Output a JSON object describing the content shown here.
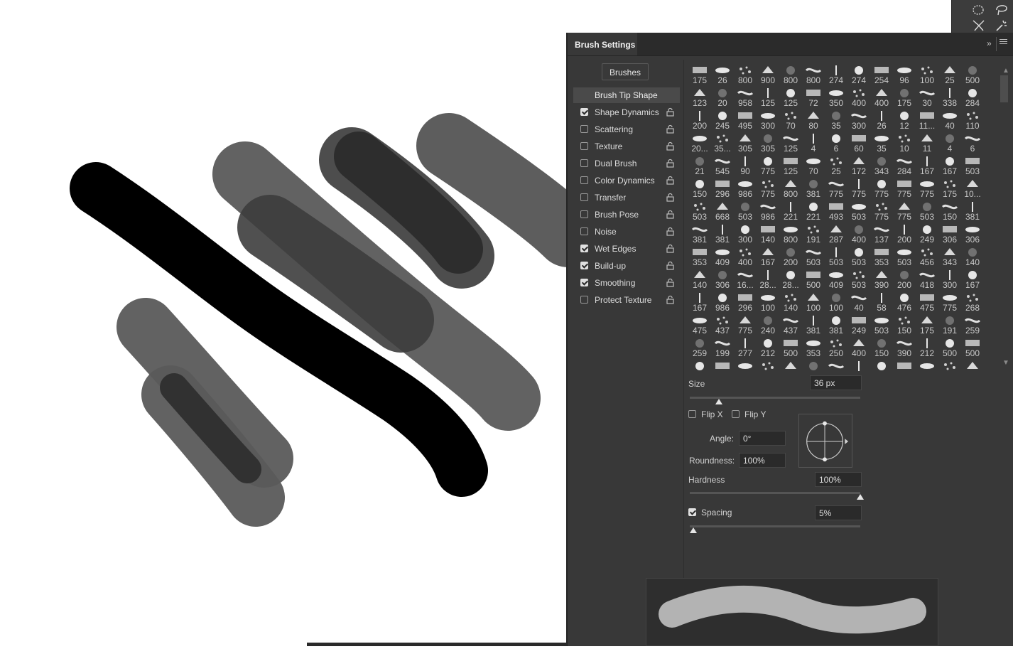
{
  "panel": {
    "title": "Brush Settings",
    "expand_glyph": "»",
    "brushes_button": "Brushes",
    "tip_shape_label": "Brush Tip Shape",
    "options": [
      {
        "label": "Shape Dynamics",
        "checked": true
      },
      {
        "label": "Scattering",
        "checked": false
      },
      {
        "label": "Texture",
        "checked": false
      },
      {
        "label": "Dual Brush",
        "checked": false
      },
      {
        "label": "Color Dynamics",
        "checked": false
      },
      {
        "label": "Transfer",
        "checked": false
      },
      {
        "label": "Brush Pose",
        "checked": false
      },
      {
        "label": "Noise",
        "checked": false
      },
      {
        "label": "Wet Edges",
        "checked": true
      },
      {
        "label": "Build-up",
        "checked": true
      },
      {
        "label": "Smoothing",
        "checked": true
      },
      {
        "label": "Protect Texture",
        "checked": false
      }
    ]
  },
  "presets": [
    [
      "175",
      "26",
      "800",
      "900",
      "800",
      "800",
      "274",
      "274",
      "254",
      "96",
      "100",
      "25",
      "500"
    ],
    [
      "123",
      "20",
      "958",
      "125",
      "125",
      "72",
      "350",
      "400",
      "400",
      "175",
      "30",
      "338",
      "284"
    ],
    [
      "200",
      "245",
      "495",
      "300",
      "70",
      "80",
      "35",
      "300",
      "26",
      "12",
      "11...",
      "40",
      "110"
    ],
    [
      "20...",
      "35...",
      "305",
      "305",
      "125",
      "4",
      "6",
      "60",
      "35",
      "10",
      "11",
      "4",
      "6"
    ],
    [
      "21",
      "545",
      "90",
      "775",
      "125",
      "70",
      "25",
      "172",
      "343",
      "284",
      "167",
      "167",
      "503"
    ],
    [
      "150",
      "296",
      "986",
      "775",
      "800",
      "381",
      "775",
      "775",
      "775",
      "775",
      "775",
      "175",
      "10..."
    ],
    [
      "503",
      "668",
      "503",
      "986",
      "221",
      "221",
      "493",
      "503",
      "775",
      "775",
      "503",
      "150",
      "381"
    ],
    [
      "381",
      "381",
      "300",
      "140",
      "800",
      "191",
      "287",
      "400",
      "137",
      "200",
      "249",
      "306",
      "306"
    ],
    [
      "353",
      "409",
      "400",
      "167",
      "200",
      "503",
      "503",
      "503",
      "353",
      "503",
      "456",
      "343",
      "140"
    ],
    [
      "140",
      "306",
      "16...",
      "28...",
      "28...",
      "500",
      "409",
      "503",
      "390",
      "200",
      "418",
      "300",
      "167"
    ],
    [
      "167",
      "986",
      "296",
      "100",
      "140",
      "100",
      "100",
      "40",
      "58",
      "476",
      "475",
      "775",
      "268"
    ],
    [
      "475",
      "437",
      "775",
      "240",
      "437",
      "381",
      "381",
      "249",
      "503",
      "150",
      "175",
      "191",
      "259"
    ],
    [
      "259",
      "199",
      "277",
      "212",
      "500",
      "353",
      "250",
      "400",
      "150",
      "390",
      "212",
      "500",
      "500"
    ],
    [
      "",
      "",
      "",
      "",
      "",
      "",
      "",
      "",
      "",
      "",
      "",
      "",
      ""
    ]
  ],
  "controls": {
    "size_label": "Size",
    "size_value": "36 px",
    "size_fraction": 0.17,
    "flip_x_label": "Flip X",
    "flip_y_label": "Flip Y",
    "angle_label": "Angle:",
    "angle_value": "0°",
    "roundness_label": "Roundness:",
    "roundness_value": "100%",
    "hardness_label": "Hardness",
    "hardness_value": "100%",
    "hardness_fraction": 1.0,
    "spacing_label": "Spacing",
    "spacing_checked": true,
    "spacing_value": "5%",
    "spacing_fraction": 0.02
  },
  "icons": [
    "ellipse-marquee-icon",
    "lasso-icon",
    "object-select-icon",
    "magic-wand-icon",
    "lock-icon",
    "panel-menu-icon"
  ],
  "colors": {
    "panel_bg": "#383838",
    "header_bg": "#2b2b2b",
    "stroke_dark": "#000000",
    "stroke_gray": "#5a5a5a",
    "preview_stroke": "#b3b3b3"
  }
}
